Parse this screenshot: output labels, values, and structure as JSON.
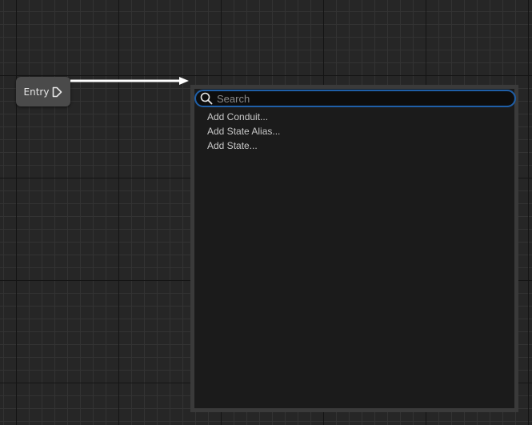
{
  "graph": {
    "entry_node": {
      "label": "Entry",
      "pin_icon": "exec-output-pin-icon"
    }
  },
  "context_menu": {
    "search": {
      "placeholder": "Search",
      "value": "",
      "icon": "search-icon",
      "border_color": "#1f5fa8"
    },
    "items": [
      {
        "label": "Add Conduit..."
      },
      {
        "label": "Add State Alias..."
      },
      {
        "label": "Add State..."
      }
    ]
  }
}
